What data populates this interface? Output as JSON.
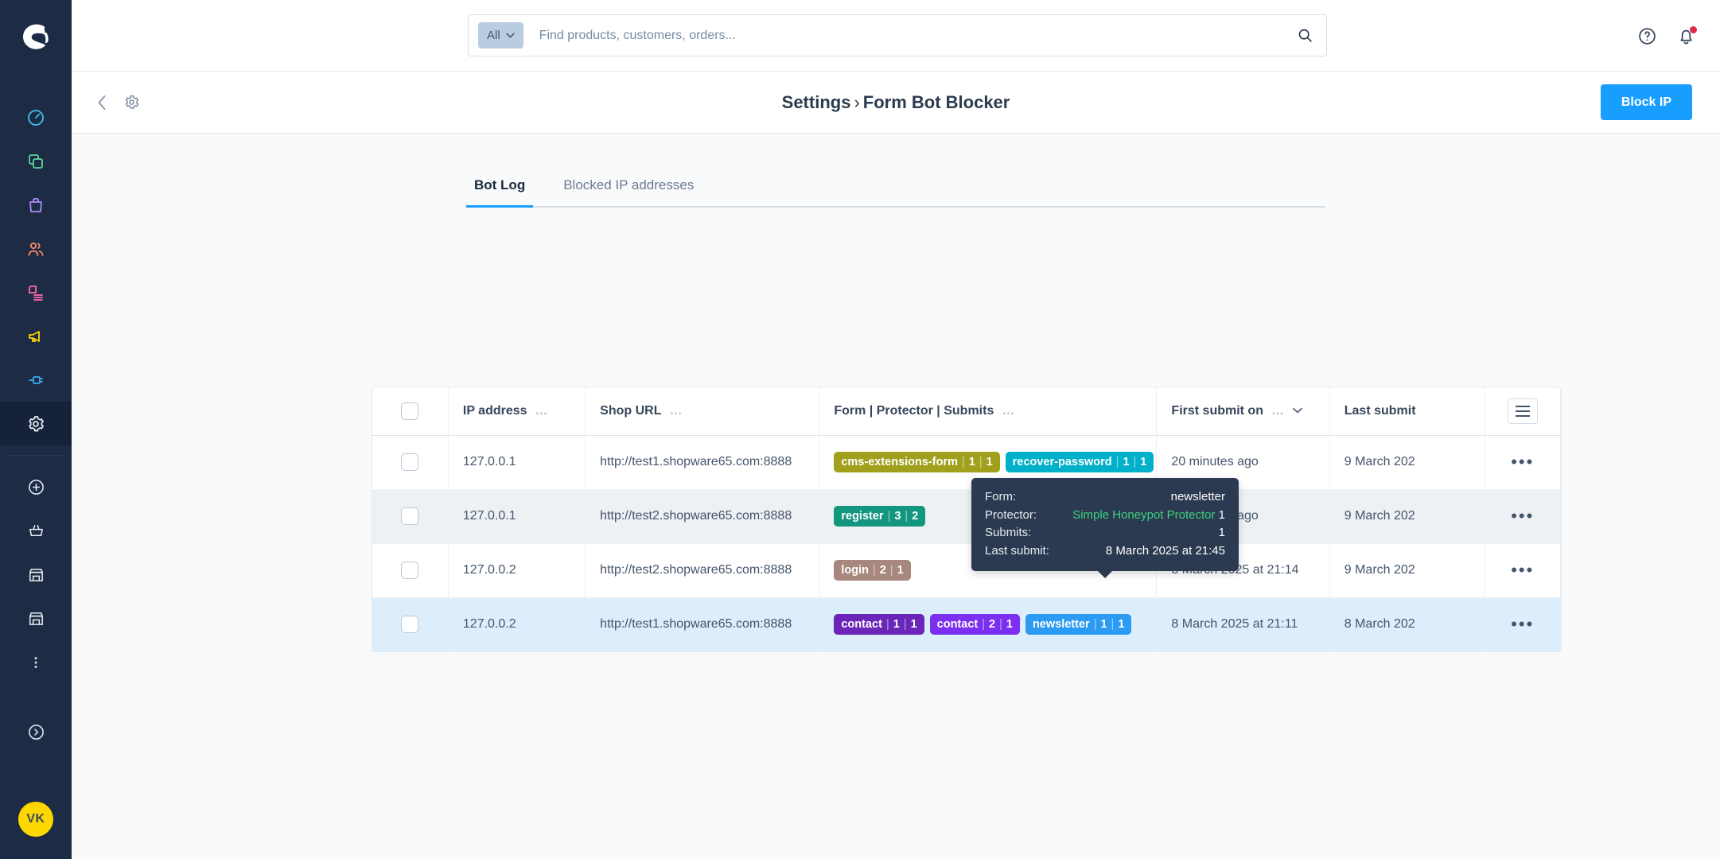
{
  "brand": {
    "logo_name": "shopware-logo",
    "accent": "#189eff",
    "sidebar_bg": "#1d2b44"
  },
  "sidebar": {
    "items": [
      {
        "name": "dashboard",
        "icon": "gauge-icon",
        "color": "#3fc3f0"
      },
      {
        "name": "catalogues",
        "icon": "copy-icon",
        "color": "#5cd59a"
      },
      {
        "name": "orders",
        "icon": "bag-icon",
        "color": "#ab8cf5"
      },
      {
        "name": "customers",
        "icon": "users-icon",
        "color": "#f88962"
      },
      {
        "name": "content",
        "icon": "content-icon",
        "color": "#ff6ba9"
      },
      {
        "name": "marketing",
        "icon": "megaphone-icon",
        "color": "#ffd700"
      },
      {
        "name": "extensions",
        "icon": "plug-icon",
        "color": "#3fa9f5"
      },
      {
        "name": "settings",
        "icon": "gear-icon",
        "color": "#ffffff",
        "active": true
      }
    ],
    "shortcuts": [
      {
        "name": "add",
        "icon": "plus-circle-icon"
      },
      {
        "name": "basket",
        "icon": "basket-icon"
      },
      {
        "name": "storefront-1",
        "icon": "store-icon"
      },
      {
        "name": "storefront-2",
        "icon": "store-icon"
      },
      {
        "name": "more",
        "icon": "more-vertical-icon"
      }
    ],
    "expand": {
      "name": "expand-sidebar",
      "icon": "chevron-right-circle-icon"
    },
    "avatar": {
      "initials": "VK",
      "color": "#ffd700"
    }
  },
  "topbar": {
    "search": {
      "scope_label": "All",
      "scope_icon": "chevron-down-icon",
      "placeholder": "Find products, customers, orders...",
      "value": "",
      "search_icon": "search-icon"
    },
    "help_icon": "help-circle-icon",
    "notifications_icon": "bell-icon",
    "has_notification": true
  },
  "pagehead": {
    "back_icon": "chevron-left-icon",
    "settings_icon": "gear-icon",
    "breadcrumb_root": "Settings",
    "breadcrumb_sep": "›",
    "breadcrumb_current": "Form Bot Blocker",
    "primary_action": "Block IP"
  },
  "tabs": [
    {
      "label": "Bot Log",
      "active": true
    },
    {
      "label": "Blocked IP addresses",
      "active": false
    }
  ],
  "table": {
    "columns": [
      {
        "key": "check",
        "label": ""
      },
      {
        "key": "ip",
        "label": "IP address",
        "menu": "…"
      },
      {
        "key": "shop",
        "label": "Shop URL",
        "menu": "…"
      },
      {
        "key": "form",
        "label": "Form | Protector | Submits",
        "menu": "…"
      },
      {
        "key": "first",
        "label": "First submit on",
        "menu": "…",
        "sorted": true,
        "sort_icon": "chevron-down-icon"
      },
      {
        "key": "last",
        "label": "Last submit"
      },
      {
        "key": "actions",
        "label": ""
      }
    ],
    "settings_button_icon": "list-settings-icon",
    "rows": [
      {
        "state": "normal",
        "ip": "127.0.0.1",
        "shop": "http://test1.shopware65.com:8888",
        "badges": [
          {
            "text": "cms-extensions-form",
            "protector": "1",
            "submits": "1",
            "color": "#a1a01c"
          },
          {
            "text": "recover-password",
            "protector": "1",
            "submits": "1",
            "color": "#00b0c8"
          }
        ],
        "first": "20 minutes ago",
        "last": "9 March 202",
        "actions": "•••"
      },
      {
        "state": "hover",
        "ip": "127.0.0.1",
        "shop": "http://test2.shopware65.com:8888",
        "badges": [
          {
            "text": "register",
            "protector": "3",
            "submits": "2",
            "color": "#13967e"
          }
        ],
        "first": "22 minutes ago",
        "last": "9 March 202",
        "actions": "•••"
      },
      {
        "state": "normal",
        "ip": "127.0.0.2",
        "shop": "http://test2.shopware65.com:8888",
        "badges": [
          {
            "text": "login",
            "protector": "2",
            "submits": "1",
            "color": "#a8887e"
          }
        ],
        "first": "8 March 2025 at 21:14",
        "last": "9 March 202",
        "actions": "•••"
      },
      {
        "state": "selected",
        "ip": "127.0.0.2",
        "shop": "http://test1.shopware65.com:8888",
        "badges": [
          {
            "text": "contact",
            "protector": "1",
            "submits": "1",
            "color": "#6b25b8"
          },
          {
            "text": "contact",
            "protector": "2",
            "submits": "1",
            "color": "#7b2ff0"
          },
          {
            "text": "newsletter",
            "protector": "1",
            "submits": "1",
            "color": "#2b9bf4"
          }
        ],
        "first": "8 March 2025 at 21:11",
        "last": "8 March 202",
        "actions": "•••"
      }
    ]
  },
  "tooltip": {
    "form_label": "Form:",
    "form_value": "newsletter",
    "protector_label": "Protector:",
    "protector_value": "Simple Honeypot Protector",
    "protector_count": "1",
    "submits_label": "Submits:",
    "submits_value": "1",
    "last_label": "Last submit:",
    "last_value": "8 March 2025 at 21:45"
  }
}
